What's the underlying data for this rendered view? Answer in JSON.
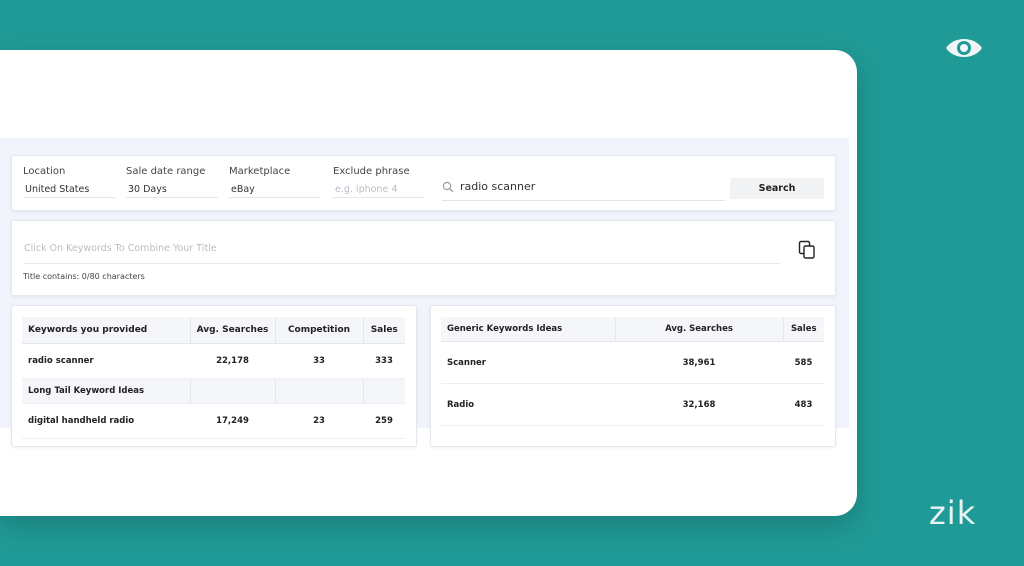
{
  "filters": {
    "location": {
      "label": "Location",
      "value": "United States"
    },
    "sale_date_range": {
      "label": "Sale date range",
      "value": "30 Days"
    },
    "marketplace": {
      "label": "Marketplace",
      "value": "eBay"
    },
    "exclude_phrase": {
      "label": "Exclude phrase",
      "placeholder": "e.g. iphone 4"
    },
    "search_query": "radio scanner",
    "search_button": "Search"
  },
  "title_builder": {
    "placeholder": "Click On Keywords To Combine Your Title",
    "counter": "Title contains: 0/80 characters"
  },
  "provided_table": {
    "headers": [
      "Keywords you provided",
      "Avg. Searches",
      "Competition",
      "Sales"
    ],
    "rows": [
      {
        "keyword": "radio scanner",
        "avg_searches": "22,178",
        "competition": "33",
        "sales": "333"
      }
    ],
    "section_title": "Long Tail Keyword Ideas",
    "long_tail_rows": [
      {
        "keyword": "digital handheld radio",
        "avg_searches": "17,249",
        "competition": "23",
        "sales": "259"
      }
    ]
  },
  "generic_table": {
    "headers": [
      "Generic Keywords Ideas",
      "Avg. Searches",
      "Sales"
    ],
    "rows": [
      {
        "keyword": "Scanner",
        "avg_searches": "38,961",
        "sales": "585"
      },
      {
        "keyword": "Radio",
        "avg_searches": "32,168",
        "sales": "483"
      }
    ]
  },
  "brand": {
    "logo_text": "zik"
  },
  "colors": {
    "background": "#209a96",
    "card": "#ffffff",
    "app_bg": "#f1f4fa"
  },
  "icons": [
    "eye-icon",
    "search-icon",
    "copy-icon"
  ]
}
